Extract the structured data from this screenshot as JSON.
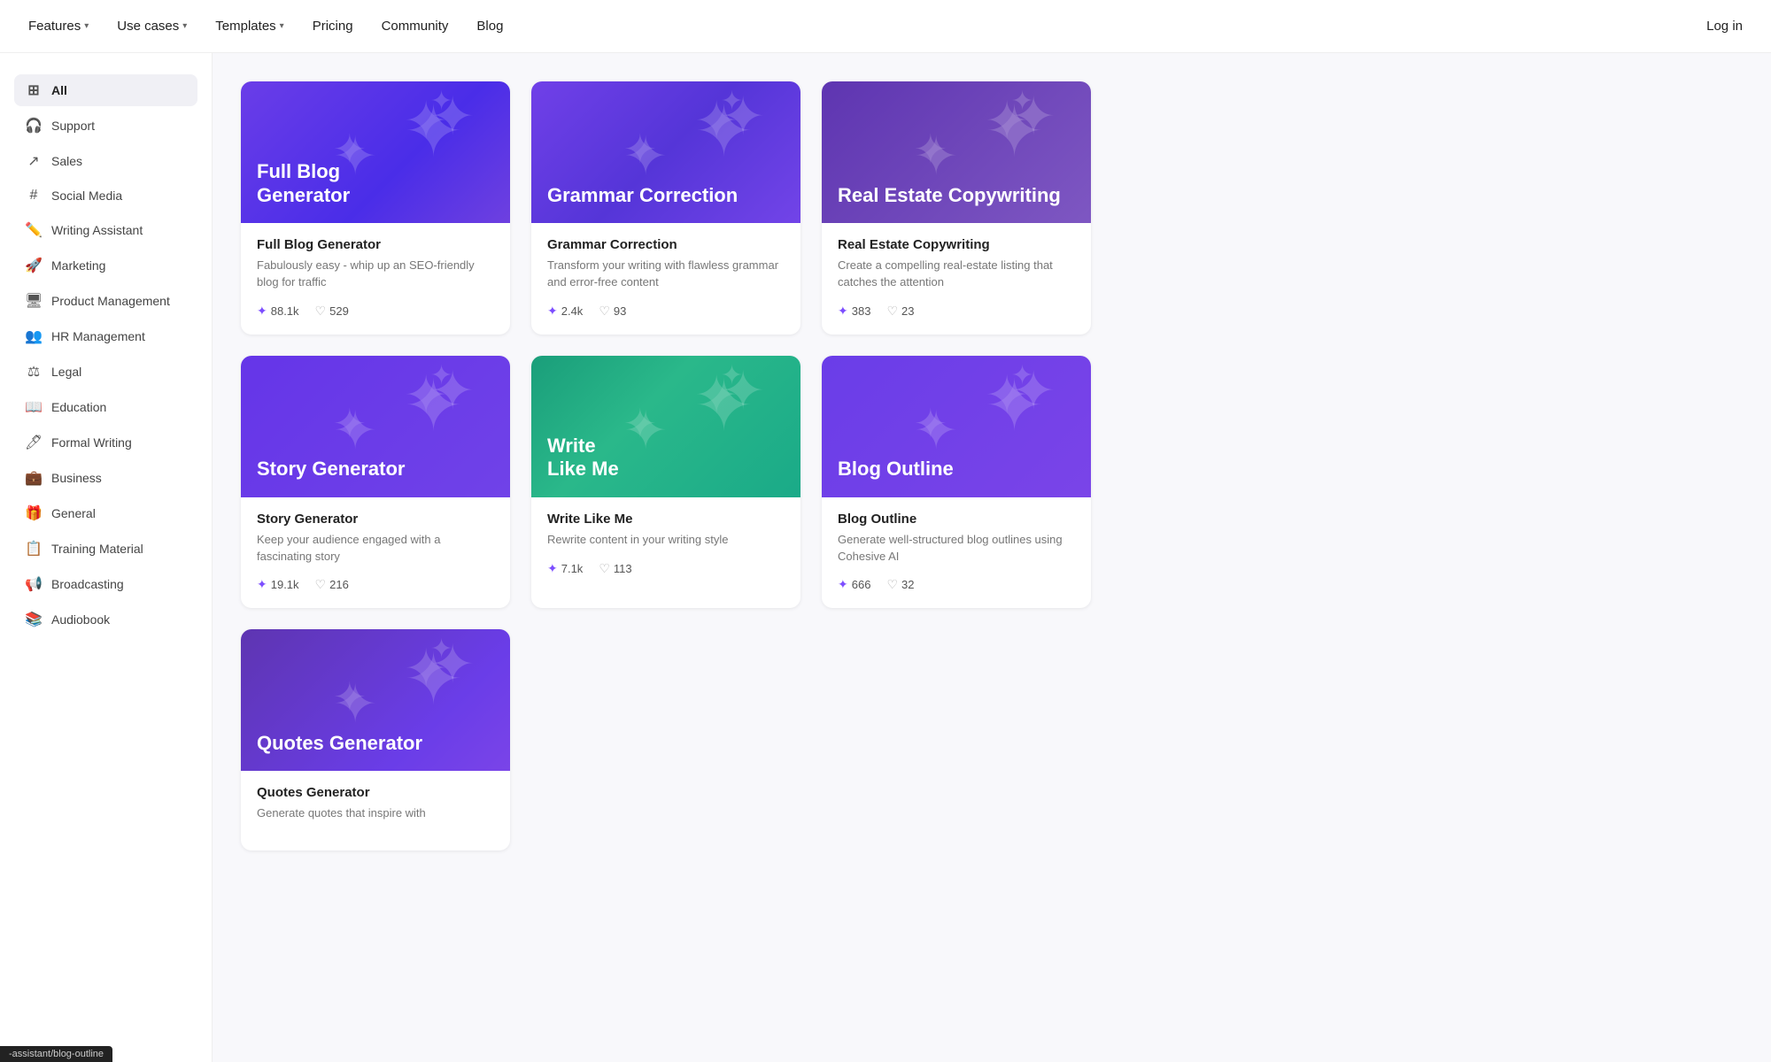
{
  "nav": {
    "items": [
      {
        "label": "Features",
        "hasChevron": true
      },
      {
        "label": "Use cases",
        "hasChevron": true
      },
      {
        "label": "Templates",
        "hasChevron": true
      },
      {
        "label": "Pricing",
        "hasChevron": false
      },
      {
        "label": "Community",
        "hasChevron": false
      },
      {
        "label": "Blog",
        "hasChevron": false
      }
    ],
    "login": "Log in"
  },
  "sidebar": {
    "items": [
      {
        "id": "all",
        "label": "All",
        "icon": "⊞",
        "active": true
      },
      {
        "id": "support",
        "label": "Support",
        "icon": "🎧"
      },
      {
        "id": "sales",
        "label": "Sales",
        "icon": "↗"
      },
      {
        "id": "social-media",
        "label": "Social Media",
        "icon": "#"
      },
      {
        "id": "writing-assistant",
        "label": "Writing Assistant",
        "icon": "✏️"
      },
      {
        "id": "marketing",
        "label": "Marketing",
        "icon": "🚀"
      },
      {
        "id": "product-management",
        "label": "Product Management",
        "icon": "🖥"
      },
      {
        "id": "hr-management",
        "label": "HR Management",
        "icon": "👥"
      },
      {
        "id": "legal",
        "label": "Legal",
        "icon": "⚖"
      },
      {
        "id": "education",
        "label": "Education",
        "icon": "📖"
      },
      {
        "id": "formal-writing",
        "label": "Formal Writing",
        "icon": "🖊"
      },
      {
        "id": "business",
        "label": "Business",
        "icon": "💼"
      },
      {
        "id": "general",
        "label": "General",
        "icon": "🎁"
      },
      {
        "id": "training-material",
        "label": "Training Material",
        "icon": "📋"
      },
      {
        "id": "broadcasting",
        "label": "Broadcasting",
        "icon": "📢"
      },
      {
        "id": "audiobook",
        "label": "Audiobook",
        "icon": "📚"
      }
    ]
  },
  "cards": [
    {
      "id": "full-blog-generator",
      "banner_title": "Full Blog\nGenerator",
      "bg_class": "bg-purple-blue",
      "title": "Full Blog Generator",
      "desc": "Fabulously easy - whip up an SEO-friendly blog for traffic",
      "uses": "88.1k",
      "likes": "529"
    },
    {
      "id": "grammar-correction",
      "banner_title": "Grammar Correction",
      "bg_class": "bg-blue-purple",
      "title": "Grammar Correction",
      "desc": "Transform your writing with flawless grammar and error-free content",
      "uses": "2.4k",
      "likes": "93"
    },
    {
      "id": "real-estate-copywriting",
      "banner_title": "Real Estate Copywriting",
      "bg_class": "bg-real-estate",
      "title": "Real Estate Copywriting",
      "desc": "Create a compelling real-estate listing that catches the attention",
      "uses": "383",
      "likes": "23"
    },
    {
      "id": "story-generator",
      "banner_title": "Story Generator",
      "bg_class": "bg-purple-mid",
      "title": "Story Generator",
      "desc": "Keep your audience engaged with a fascinating story",
      "uses": "19.1k",
      "likes": "216"
    },
    {
      "id": "write-like-me",
      "banner_title": "Write\nLike Me",
      "bg_class": "bg-teal-green",
      "title": "Write Like Me",
      "desc": "Rewrite content in your writing style",
      "uses": "7.1k",
      "likes": "113"
    },
    {
      "id": "blog-outline",
      "banner_title": "Blog Outline",
      "bg_class": "bg-blog-outline",
      "title": "Blog Outline",
      "desc": "Generate well-structured blog outlines using Cohesive AI",
      "uses": "666",
      "likes": "32"
    },
    {
      "id": "quotes-generator",
      "banner_title": "Quotes Generator",
      "bg_class": "bg-quotes",
      "title": "Quotes Generator",
      "desc": "Generate quotes that inspire with",
      "uses": "",
      "likes": ""
    }
  ],
  "status_bar": {
    "text": "-assistant/blog-outline"
  }
}
